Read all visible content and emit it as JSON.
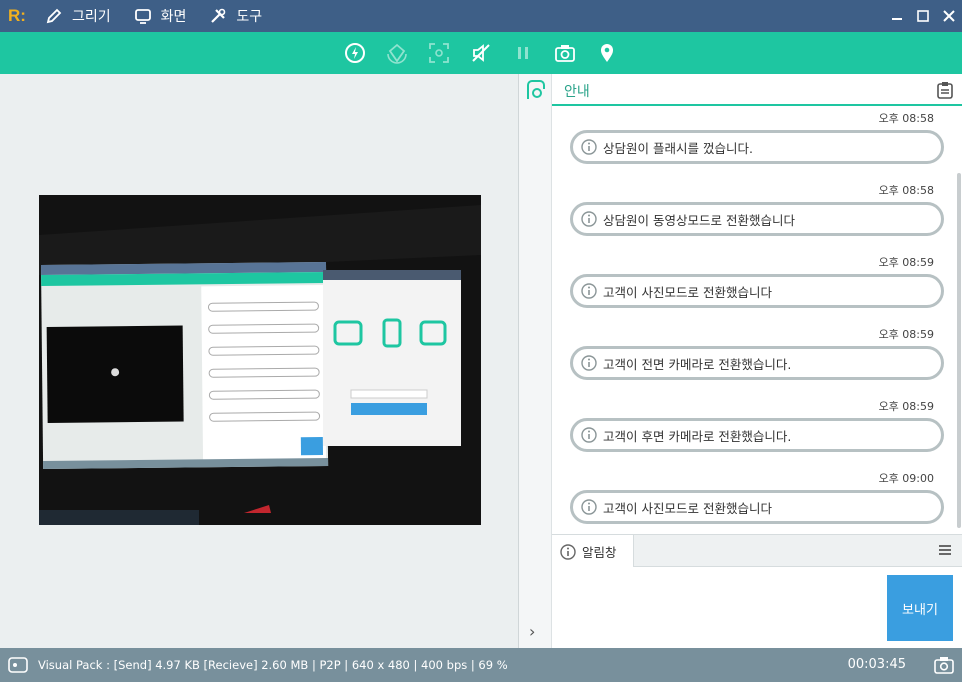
{
  "app": {
    "logo": "R:",
    "menu": [
      {
        "label": "그리기",
        "icon": "pen-icon"
      },
      {
        "label": "화면",
        "icon": "monitor-icon"
      },
      {
        "label": "도구",
        "icon": "tools-icon"
      }
    ]
  },
  "toolbar": {
    "buttons": [
      "flash-icon",
      "rotate-icon",
      "focus-icon",
      "mute-icon",
      "pause-icon",
      "camera-icon",
      "location-icon"
    ]
  },
  "chat": {
    "title": "안내",
    "messages": [
      {
        "time": "오후 08:58",
        "text": "상담원이 플래시를 껐습니다."
      },
      {
        "time": "오후 08:58",
        "text": "상담원이 동영상모드로 전환했습니다"
      },
      {
        "time": "오후 08:59",
        "text": "고객이 사진모드로 전환했습니다"
      },
      {
        "time": "오후 08:59",
        "text": "고객이 전면 카메라로 전환했습니다."
      },
      {
        "time": "오후 08:59",
        "text": "고객이 후면 카메라로 전환했습니다."
      },
      {
        "time": "오후 09:00",
        "text": "고객이 사진모드로 전환했습니다"
      }
    ]
  },
  "alert_tab": {
    "label": "알림창"
  },
  "send": {
    "label": "보내기"
  },
  "status": {
    "text": "Visual Pack : [Send] 4.97 KB  [Recieve] 2.60 MB | P2P  | 640 x 480 | 400 bps | 69 %",
    "timer": "00:03:45"
  },
  "colors": {
    "titlebar": "#3e5f87",
    "toolbar": "#1ec6a1",
    "accent": "#2aa38a",
    "send": "#3a9ee0",
    "status": "#78909c"
  }
}
